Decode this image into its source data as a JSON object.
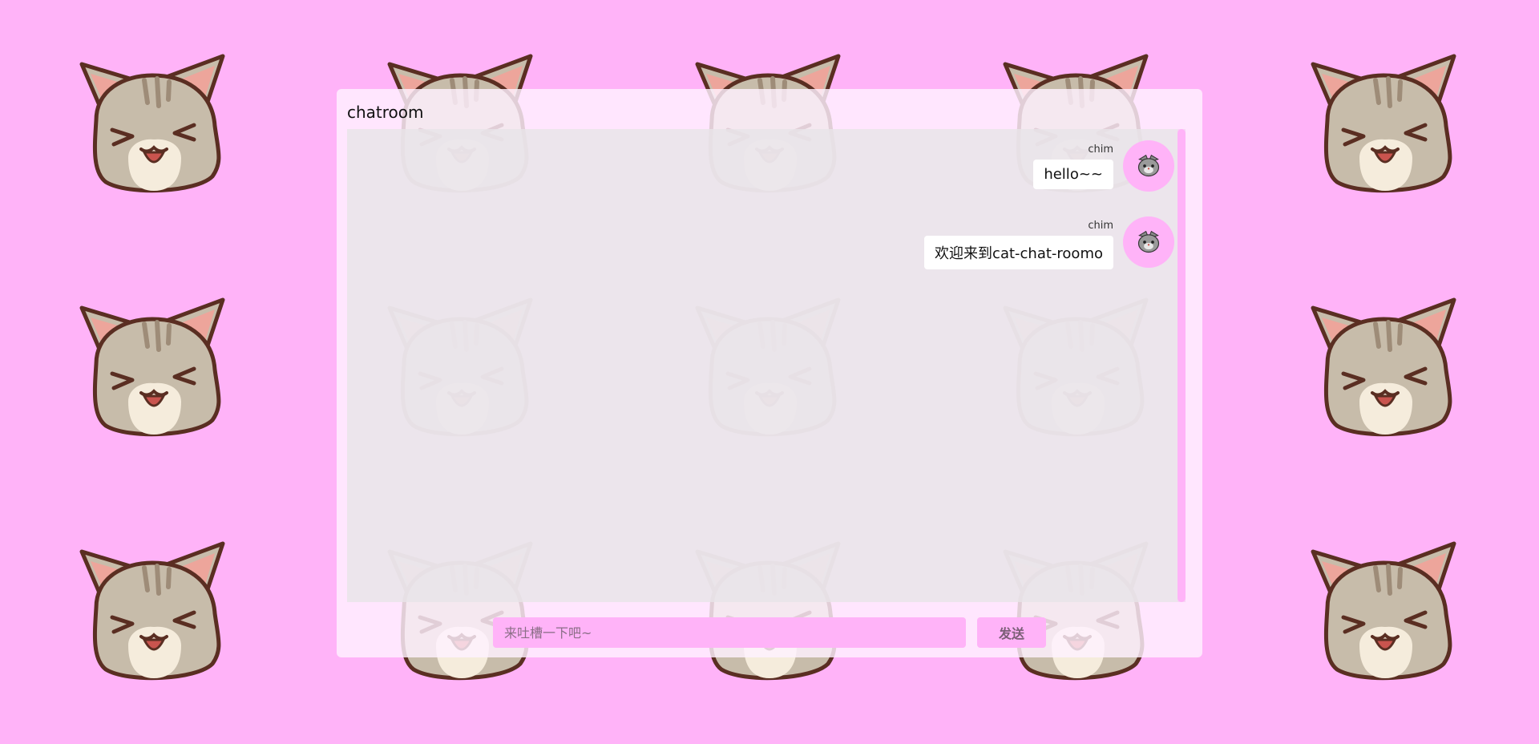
{
  "colors": {
    "background": "#ffb3f8",
    "accent": "#ffb3f8",
    "panel": "#fff2ff",
    "bubble": "#ffffff"
  },
  "background": {
    "pattern_icon": "laughing-cat-face-icon"
  },
  "chatroom": {
    "title": "chatroom",
    "messages": [
      {
        "sender": "chim",
        "text": "hello~~",
        "avatar_icon": "gray-cat-avatar-icon"
      },
      {
        "sender": "chim",
        "text": "欢迎来到cat-chat-roomo",
        "avatar_icon": "gray-cat-avatar-icon"
      }
    ],
    "input": {
      "placeholder": "来吐槽一下吧~",
      "value": ""
    },
    "send_label": "发送"
  }
}
